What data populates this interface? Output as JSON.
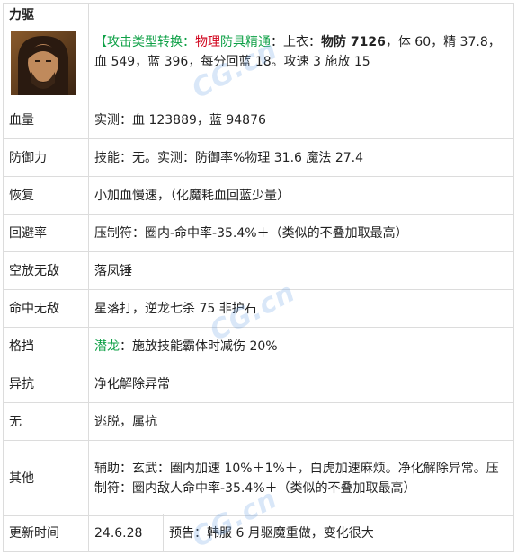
{
  "header": {
    "name": "力驱",
    "bracket_open": "【",
    "attack_conversion_label": "攻击类型转换：",
    "attack_conversion_value": "物理",
    "armor_mastery_label": "防具精通",
    "armor_intro": "：上衣：",
    "armor_def": "物防 7126",
    "armor_rest": "，体 60，精 37.8，血 549，蓝 396，每分回蓝 18。攻速 3 施放 15"
  },
  "rows": [
    {
      "label": "血量",
      "value": "实测：血 123889，蓝 94876"
    },
    {
      "label": "防御力",
      "value": "技能：无。实测：防御率%物理 31.6 魔法 27.4"
    },
    {
      "label": "恢复",
      "value": "小加血慢速，（化魔耗血回蓝少量）"
    },
    {
      "label": "回避率",
      "value": "压制符：圈内-命中率-35.4%＋（类似的不叠加取最高）"
    },
    {
      "label": "空放无敌",
      "value": "落凤锤"
    },
    {
      "label": "命中无敌",
      "value": "星落打，逆龙七杀 75 非护石"
    },
    {
      "label": "格挡",
      "highlight": "潜龙",
      "value": "：施放技能霸体时减伤 20%"
    },
    {
      "label": "异抗",
      "value": "净化解除异常"
    },
    {
      "label": "无",
      "value": "逃脱，属抗"
    },
    {
      "label": "其他",
      "value": "辅助：玄武：圈内加速 10%＋1%＋，白虎加速麻烦。净化解除异常。压制符：圈内敌人命中率-35.4%＋（类似的不叠加取最高）"
    }
  ],
  "update": {
    "label": "更新时间",
    "date": "24.6.28",
    "note": "预告：韩服 6 月驱魔重做，变化很大"
  },
  "watermark": {
    "text": "CG.cn"
  }
}
